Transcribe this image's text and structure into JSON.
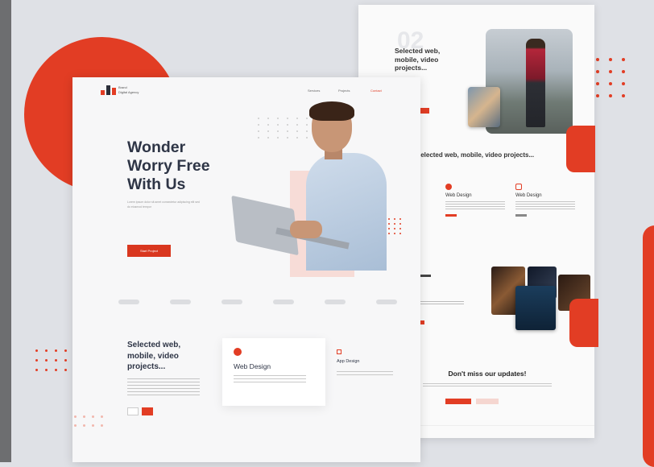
{
  "colors": {
    "accent": "#e23d24",
    "dark": "#2e3546",
    "background": "#dfe1e6"
  },
  "front": {
    "brand": {
      "line1": "Brand",
      "line2": "Digital Agency"
    },
    "nav": [
      "Services",
      "Projects",
      "Contact"
    ],
    "hero": {
      "title": "Wonder Worry Free With Us",
      "text": "Lorem ipsum dolor sit amet consectetur adipiscing elit sed do eiusmod tempor",
      "cta": "Start Project"
    },
    "section": {
      "title": "Selected web, mobile, video projects...",
      "card_title": "Web Design",
      "card2_title": "App Design"
    }
  },
  "back": {
    "number": "02",
    "top_title": "Selected web, mobile, video projects...",
    "mid_title": "Selected web, mobile, video projects...",
    "cards": [
      {
        "title": "Web Design"
      },
      {
        "title": "Web Design"
      }
    ],
    "subscribe_title": "Don't miss our updates!"
  },
  "icons": [
    "logo-icon",
    "web-design-icon",
    "app-design-icon"
  ]
}
